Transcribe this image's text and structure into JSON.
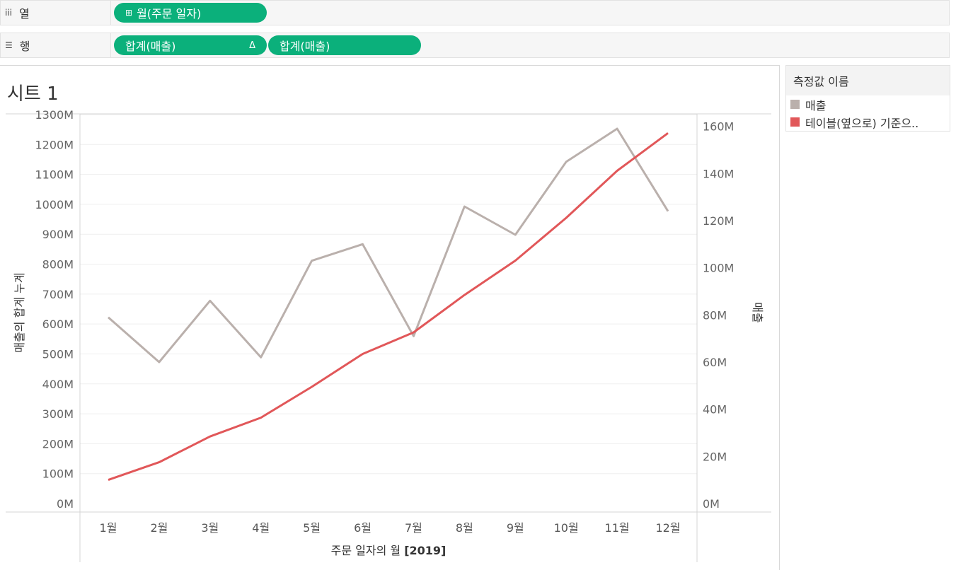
{
  "columns_shelf": {
    "label": "열",
    "icon": "columns-icon",
    "pill": {
      "icon": "expand-plus-icon",
      "label": "월(주문 일자)"
    }
  },
  "rows_shelf": {
    "label": "행",
    "icon": "rows-icon",
    "pills": [
      {
        "label": "합계(매출)",
        "marker": "Δ"
      },
      {
        "label": "합계(매출)"
      }
    ]
  },
  "sheet": {
    "title": "시트 1"
  },
  "legend": {
    "title": "측정값 이름",
    "items": [
      {
        "label": "매출",
        "color": "#bab0ac"
      },
      {
        "label": "테이블(옆으로) 기준으..",
        "color": "#e15759"
      }
    ]
  },
  "colors": {
    "pill": "#0bb07b",
    "cumulative_line": "#e15759",
    "sales_line": "#bab0ac"
  },
  "chart_data": {
    "type": "line",
    "categories": [
      "1월",
      "2월",
      "3월",
      "4월",
      "5월",
      "6월",
      "7월",
      "8월",
      "9월",
      "10월",
      "11월",
      "12월"
    ],
    "xlabel_prefix": "주문 일자의 월 ",
    "xlabel_bold": "[2019]",
    "left_axis": {
      "label": "매출의 합계 누계",
      "range": [
        0,
        1300
      ],
      "ticks": [
        0,
        100,
        200,
        300,
        400,
        500,
        600,
        700,
        800,
        900,
        1000,
        1100,
        1200,
        1300
      ],
      "tick_labels": [
        "0M",
        "100M",
        "200M",
        "300M",
        "400M",
        "500M",
        "600M",
        "700M",
        "800M",
        "900M",
        "1000M",
        "1100M",
        "1200M",
        "1300M"
      ]
    },
    "right_axis": {
      "label": "매출",
      "range": [
        0,
        165
      ],
      "ticks": [
        0,
        20,
        40,
        60,
        80,
        100,
        120,
        140,
        160
      ],
      "tick_labels": [
        "0M",
        "20M",
        "40M",
        "60M",
        "80M",
        "100M",
        "120M",
        "140M",
        "160M"
      ]
    },
    "series": [
      {
        "name": "매출",
        "axis": "right",
        "values": [
          79,
          60,
          86,
          62,
          103,
          110,
          71,
          126,
          114,
          145,
          159,
          124
        ]
      },
      {
        "name": "테이블(옆으로) 기준으..",
        "axis": "left",
        "values": [
          79,
          138,
          224,
          287,
          390,
          500,
          572,
          697,
          812,
          955,
          1112,
          1238
        ]
      }
    ],
    "grid": true,
    "legend_position": "right"
  }
}
